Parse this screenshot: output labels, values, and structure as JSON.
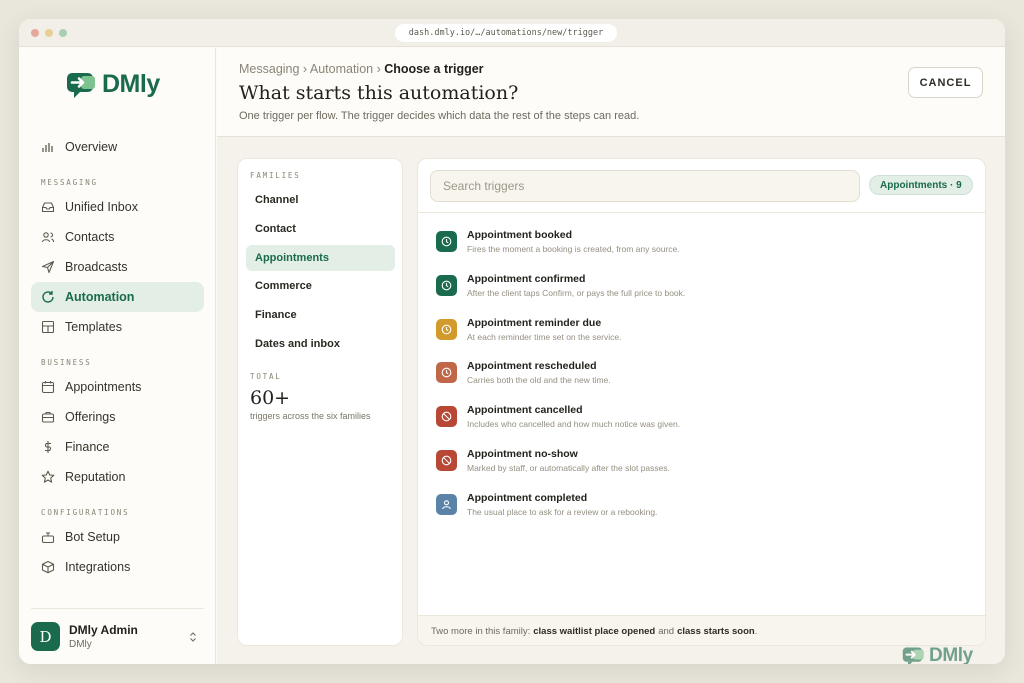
{
  "browser": {
    "url": "dash.dmly.io/…/automations/new/trigger"
  },
  "brand": {
    "name": "DMly"
  },
  "sidebar": {
    "overview": "Overview",
    "sections": [
      {
        "label": "MESSAGING",
        "items": [
          "Unified Inbox",
          "Contacts",
          "Broadcasts",
          "Automation",
          "Templates"
        ]
      },
      {
        "label": "BUSINESS",
        "items": [
          "Appointments",
          "Offerings",
          "Finance",
          "Reputation"
        ]
      },
      {
        "label": "CONFIGURATIONS",
        "items": [
          "Bot Setup",
          "Integrations"
        ]
      }
    ],
    "active_item": "Automation",
    "user": {
      "initial": "D",
      "name": "DMly Admin",
      "org": "DMly"
    }
  },
  "header": {
    "breadcrumb": [
      "Messaging",
      "Automation",
      "Choose a trigger"
    ],
    "title": "What starts this automation?",
    "subtitle": "One trigger per flow. The trigger decides which data the rest of the steps can read.",
    "cancel_label": "CANCEL"
  },
  "families": {
    "label": "FAMILIES",
    "items": [
      "Channel",
      "Contact",
      "Appointments",
      "Commerce",
      "Finance",
      "Dates and inbox"
    ],
    "active": "Appointments",
    "total_label": "TOTAL",
    "total_value": "60+",
    "total_caption": "triggers across the six families"
  },
  "search": {
    "placeholder": "Search triggers"
  },
  "filter_pill": "Appointments · 9",
  "triggers": [
    {
      "title": "Appointment booked",
      "desc": "Fires the moment a booking is created, from any source.",
      "icon": "clock-icon",
      "color": "#1a6b4d"
    },
    {
      "title": "Appointment confirmed",
      "desc": "After the client taps Confirm, or pays the full price to book.",
      "icon": "clock-icon",
      "color": "#1a6b4d"
    },
    {
      "title": "Appointment reminder due",
      "desc": "At each reminder time set on the service.",
      "icon": "clock-icon",
      "color": "#d19a2a"
    },
    {
      "title": "Appointment rescheduled",
      "desc": "Carries both the old and the new time.",
      "icon": "clock-icon",
      "color": "#c0674a"
    },
    {
      "title": "Appointment cancelled",
      "desc": "Includes who cancelled and how much notice was given.",
      "icon": "ban-icon",
      "color": "#b84735"
    },
    {
      "title": "Appointment no-show",
      "desc": "Marked by staff, or automatically after the slot passes.",
      "icon": "ban-icon",
      "color": "#b84735"
    },
    {
      "title": "Appointment completed",
      "desc": "The usual place to ask for a review or a rebooking.",
      "icon": "user-icon",
      "color": "#5b83a8"
    }
  ],
  "footer": {
    "prefix": "Two more in this family:",
    "item1": "class waitlist place opened",
    "joiner": "and",
    "item2": "class starts soon",
    "suffix": "."
  },
  "colors": {
    "accent": "#1a6b4d",
    "accent_soft": "#e3eee6"
  }
}
